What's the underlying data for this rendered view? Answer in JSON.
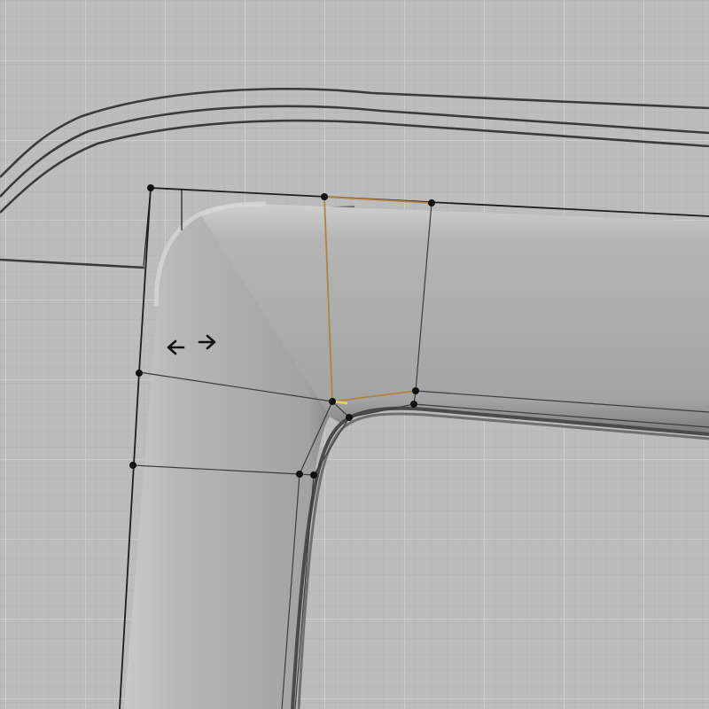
{
  "viewport": {
    "background_color": "#bcbcbc",
    "grid_minor_color": "#b3b3b3",
    "grid_major_color": "#cdcdcd",
    "wire_color": "#2a2a2a",
    "selected_edge_color": "#b0843c",
    "active_vertex_color": "#f2d36a",
    "mesh_fill_color": "#a6a6a6"
  },
  "icons": {
    "move_cursor": "horizontal-move-arrows"
  }
}
